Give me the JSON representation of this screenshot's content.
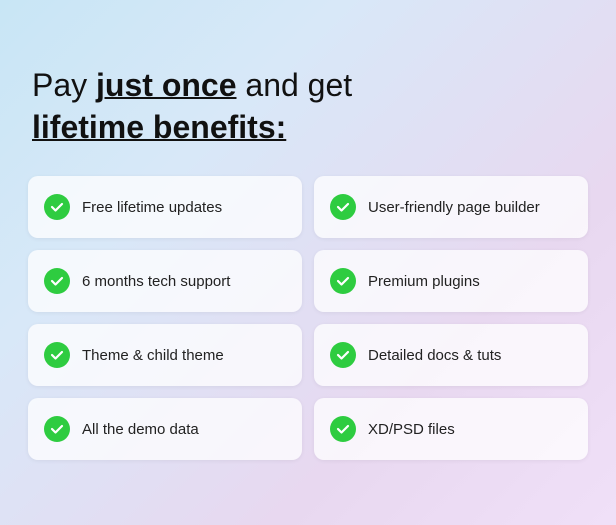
{
  "headline": {
    "line1": "Pay ",
    "line1_emphasis": "just once",
    "line1_rest": " and get",
    "line2": "lifetime benefits:"
  },
  "benefits": [
    {
      "id": "free-updates",
      "text": "Free lifetime updates"
    },
    {
      "id": "page-builder",
      "text": "User-friendly page builder"
    },
    {
      "id": "tech-support",
      "text": "6 months tech support"
    },
    {
      "id": "premium-plugins",
      "text": "Premium plugins"
    },
    {
      "id": "child-theme",
      "text": "Theme & child theme"
    },
    {
      "id": "docs-tuts",
      "text": "Detailed docs & tuts"
    },
    {
      "id": "demo-data",
      "text": "All the demo data"
    },
    {
      "id": "xd-psd",
      "text": "XD/PSD files"
    }
  ]
}
